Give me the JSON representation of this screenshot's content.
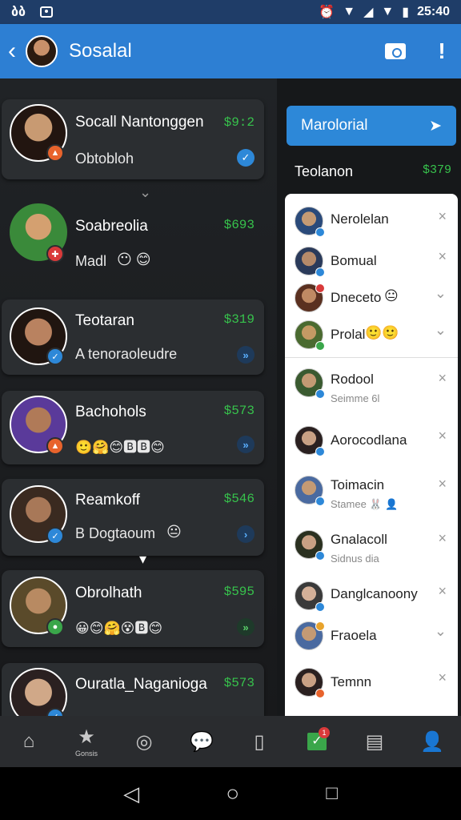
{
  "status": {
    "left_text": "ბბ",
    "time": "25:40"
  },
  "appbar": {
    "title": "Sosalal"
  },
  "feed": [
    {
      "name": "Socall Nantonggen",
      "amount": "$9:2",
      "sub": "Obtobloh",
      "emoji": "",
      "color": "#b77a56",
      "badge": "#e8632c",
      "action": "#2d88d8",
      "action_icon": "✓"
    },
    {
      "name": "Soabreolia",
      "amount": "$693",
      "sub": "Madl",
      "emoji": "😶 😊",
      "color": "#c9985e",
      "badge": "#d93a3a",
      "action": "",
      "action_icon": ""
    },
    {
      "name": "Teotaran",
      "amount": "$319",
      "sub": "A tenoraoleudre",
      "emoji": "",
      "color": "#a06c48",
      "badge": "#2d88d8",
      "action": "#2d88d8",
      "action_icon": "»"
    },
    {
      "name": "Bachohols",
      "amount": "$573",
      "sub": "",
      "emoji": "🙂🤗😊🅱🅱😊",
      "color": "#7a4da8",
      "badge": "#e8632c",
      "action": "#2d88d8",
      "action_icon": "»"
    },
    {
      "name": "Reamkoff",
      "amount": "$546",
      "sub": "B Dogtaoum",
      "emoji": "😐",
      "color": "#6b4a3a",
      "badge": "#2d88d8",
      "action": "#2d88d8",
      "action_icon": "›"
    },
    {
      "name": "Obrolhath",
      "amount": "$595",
      "sub": "",
      "emoji": "😀😊🤗😵🅱😊",
      "color": "#b08050",
      "badge": "#3aa64a",
      "action": "#3aa64a",
      "action_icon": "»"
    },
    {
      "name": "Ouratla_Naganioga",
      "amount": "$573",
      "sub": "",
      "emoji": "",
      "color": "#c8a080",
      "badge": "#2d88d8",
      "action": "",
      "action_icon": ""
    }
  ],
  "side": {
    "filter_label": "Marolorial",
    "total_label": "Teolanon",
    "total_value": "$379",
    "people": [
      {
        "name": "Nerolelan",
        "status": "",
        "mark": "×",
        "color": "#c49a74",
        "badge": "#2d88d8"
      },
      {
        "name": "Bomual",
        "status": "",
        "mark": "×",
        "color": "#4a5c7a",
        "badge": "#2d88d8"
      },
      {
        "name": "Dneceto",
        "status": "😐",
        "mark": "⌄",
        "color": "#b07050",
        "badge": "#d93a3a"
      },
      {
        "name": "Prolal",
        "status": "🙂🙂",
        "mark": "⌄",
        "color": "#8a9a50",
        "badge": "#3aa64a"
      },
      {
        "name": "Rodool",
        "status": "Seimme 6l",
        "mark": "×",
        "color": "#6a8a60",
        "badge": "#2d88d8"
      },
      {
        "name": "Aorocodlana",
        "status": "",
        "mark": "×",
        "color": "#8a6a5a",
        "badge": "#2d88d8"
      },
      {
        "name": "Toimacin",
        "status": "Stamee 🐰 👤",
        "mark": "×",
        "color": "#5a7aa0",
        "badge": "#2d88d8"
      },
      {
        "name": "Gnalacoll",
        "status": "Sidnus dia",
        "mark": "×",
        "color": "#3a6040",
        "badge": "#2d88d8"
      },
      {
        "name": "Danglcanoony",
        "status": "",
        "mark": "×",
        "color": "#c0b0a0",
        "badge": "#2d88d8"
      },
      {
        "name": "Fraoela",
        "status": "",
        "mark": "⌄",
        "color": "#5a7aa0",
        "badge": "#e8a32c"
      },
      {
        "name": "Temnn",
        "status": "",
        "mark": "×",
        "color": "#6a4a3a",
        "badge": "#e8632c"
      }
    ]
  },
  "nav": {
    "star_label": "Gonsis",
    "badge_count": "1"
  },
  "colors": {
    "accent": "#2d88d8",
    "money": "#37c24c",
    "appbar": "#2d7fd3"
  }
}
